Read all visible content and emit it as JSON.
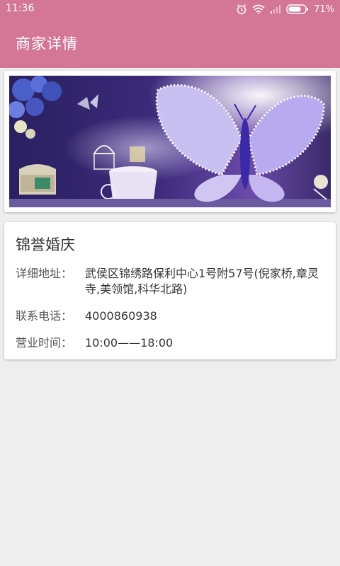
{
  "status_bar": {
    "time": "11:36",
    "battery": "71%",
    "icons": [
      "alarm-icon",
      "wifi-icon",
      "signal-icon",
      "battery-icon"
    ]
  },
  "app_bar": {
    "title": "商家详情"
  },
  "merchant": {
    "name": "锦誉婚庆",
    "rows": [
      {
        "label": "详细地址：",
        "value": "武侯区锦绣路保利中心1号附57号(倪家桥,章灵寺,美领馆,科华北路)"
      },
      {
        "label": "联系电话：",
        "value": "4000860938"
      },
      {
        "label": "营业时间：",
        "value": "10:00——18:00"
      }
    ]
  },
  "colors": {
    "primary": "#d47696",
    "background": "#eeeeee",
    "card": "#ffffff"
  }
}
